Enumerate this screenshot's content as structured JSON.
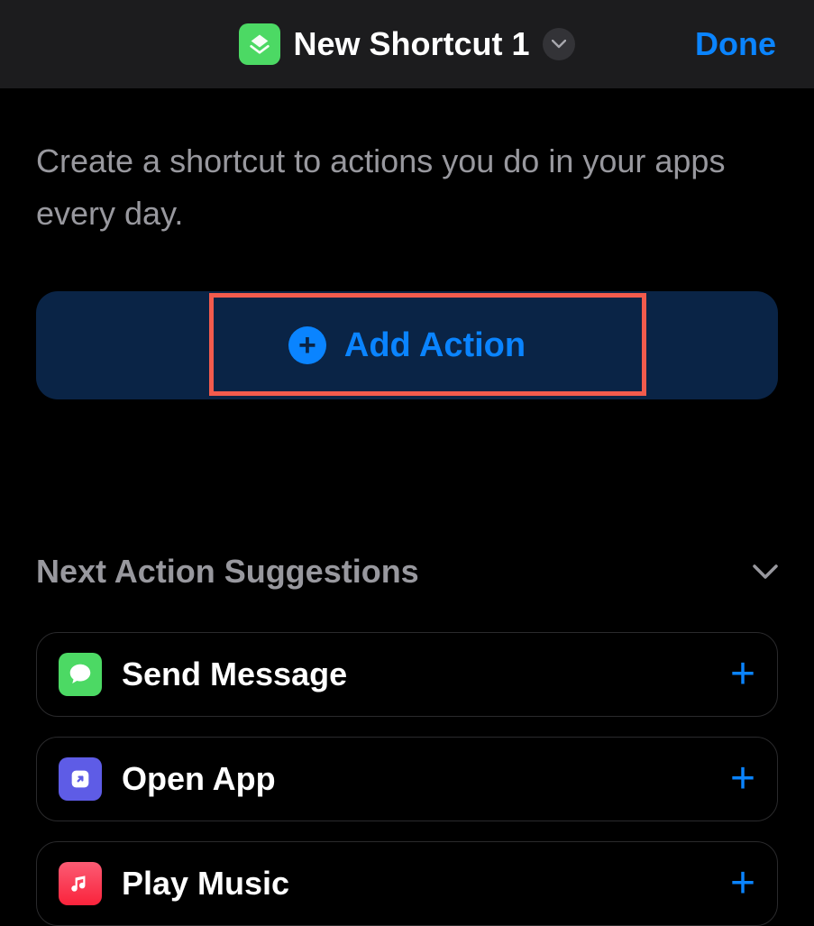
{
  "header": {
    "title": "New Shortcut 1",
    "done_label": "Done"
  },
  "instruction": "Create a shortcut to actions you do in your apps every day.",
  "add_action": {
    "label": "Add Action"
  },
  "suggestions": {
    "title": "Next Action Suggestions",
    "items": [
      {
        "label": "Send Message",
        "icon": "messages-icon"
      },
      {
        "label": "Open App",
        "icon": "shortcuts-open-icon"
      },
      {
        "label": "Play Music",
        "icon": "music-icon"
      }
    ]
  }
}
